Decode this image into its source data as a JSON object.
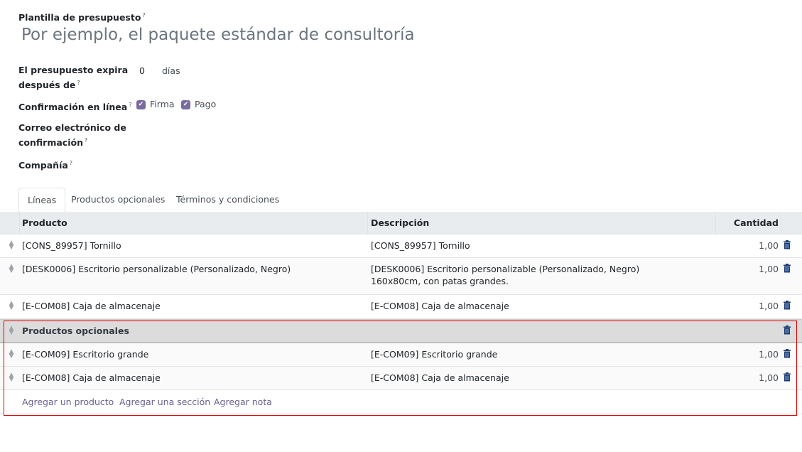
{
  "form": {
    "template_label": "Plantilla de presupuesto",
    "template_placeholder": "Por ejemplo, el paquete estándar de consultoría",
    "expire_label_1": "El presupuesto expira",
    "expire_label_2": "después de",
    "expire_value": "0",
    "expire_unit": "días",
    "confirm_label": "Confirmación en línea",
    "sign_label": "Firma",
    "pay_label": "Pago",
    "email_label_1": "Correo electrónico de",
    "email_label_2": "confirmación",
    "company_label": "Compañía",
    "help": "?"
  },
  "tabs": [
    "Líneas",
    "Productos opcionales",
    "Términos y condiciones"
  ],
  "table": {
    "headers": {
      "product": "Producto",
      "description": "Descripción",
      "quantity": "Cantidad"
    },
    "rows": [
      {
        "product": "[CONS_89957] Tornillo",
        "description": "[CONS_89957] Tornillo",
        "qty": "1,00"
      },
      {
        "product": "[DESK0006] Escritorio personalizable (Personalizado, Negro)",
        "description": "[DESK0006] Escritorio personalizable (Personalizado, Negro)",
        "description2": "160x80cm, con patas grandes.",
        "qty": "1,00"
      },
      {
        "product": "[E-COM08] Caja de almacenaje",
        "description": "[E-COM08] Caja de almacenaje",
        "qty": "1,00"
      }
    ],
    "section": "Productos opcionales",
    "section_rows": [
      {
        "product": "[E-COM09] Escritorio grande",
        "description": "[E-COM09] Escritorio grande",
        "qty": "1,00"
      },
      {
        "product": "[E-COM08] Caja de almacenaje",
        "description": "[E-COM08] Caja de almacenaje",
        "qty": "1,00"
      }
    ],
    "add_product": "Agregar un producto",
    "add_section": "Agregar una sección",
    "add_note": "Agregar nota"
  }
}
